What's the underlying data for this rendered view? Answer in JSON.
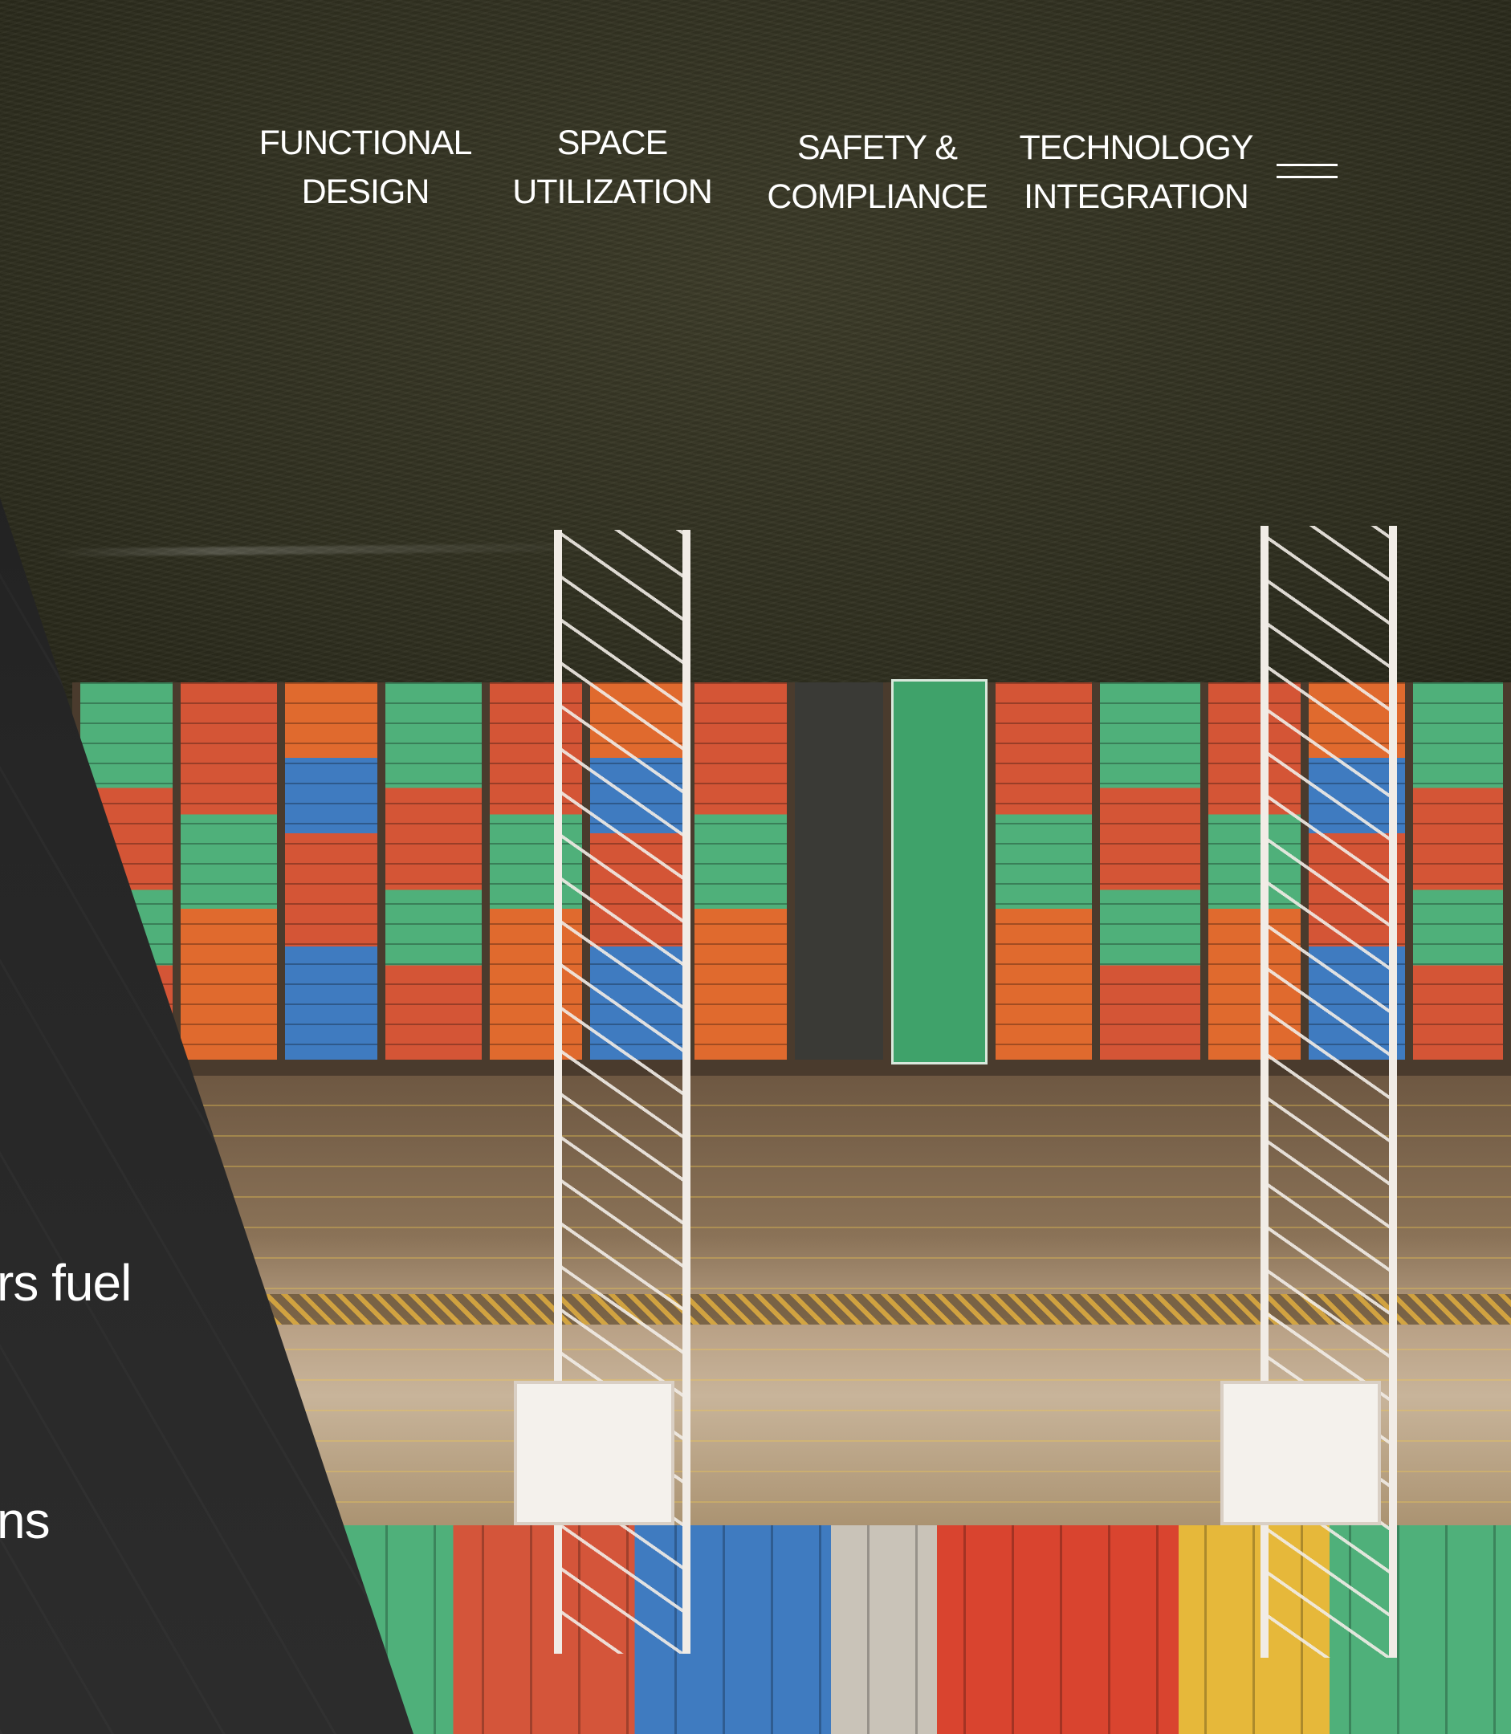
{
  "nav": {
    "items": [
      {
        "line1": "FUNCTIONAL",
        "line2": "DESIGN"
      },
      {
        "line1": "SPACE",
        "line2": "UTILIZATION"
      },
      {
        "line1": "SAFETY &",
        "line2": "COMPLIANCE"
      },
      {
        "line1": "TECHNOLOGY",
        "line2": "INTEGRATION"
      }
    ],
    "menu_icon": "hamburger-menu-icon"
  },
  "hero": {
    "panel_text_1": "rs fuel",
    "panel_text_2": "ns"
  },
  "colors": {
    "panel": "#262626",
    "nav_text": "#ffffff",
    "water": "#2e2e1f"
  }
}
